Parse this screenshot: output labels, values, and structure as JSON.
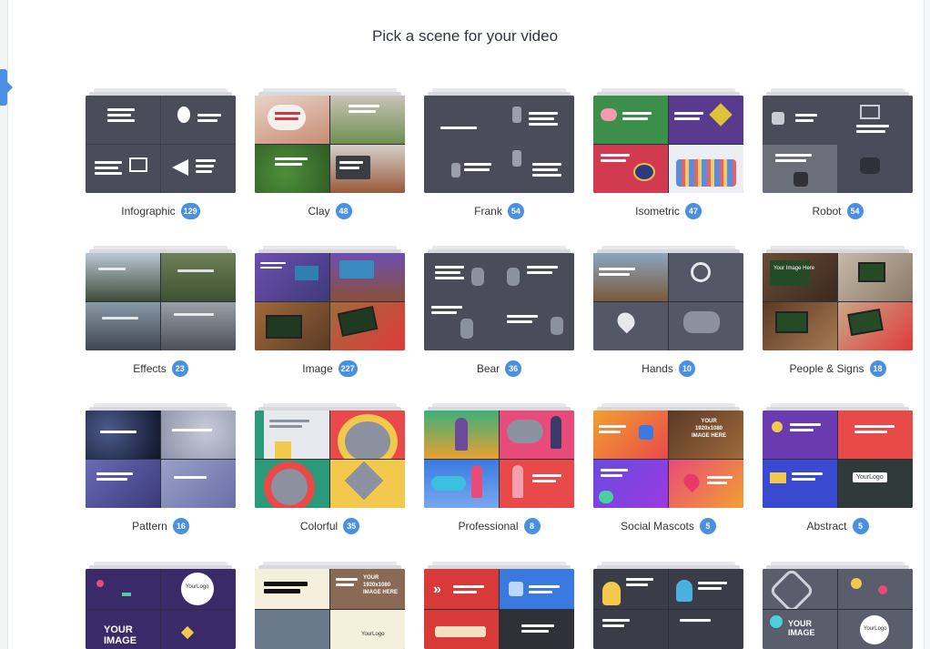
{
  "page": {
    "title": "Pick a scene for your video"
  },
  "colors": {
    "accent": "#4a90e2"
  },
  "scenes": [
    {
      "name": "Infographic",
      "count": "129",
      "theme": "dark-gray"
    },
    {
      "name": "Clay",
      "count": "48",
      "theme": "clay"
    },
    {
      "name": "Frank",
      "count": "54",
      "theme": "dark-gray"
    },
    {
      "name": "Isometric",
      "count": "47",
      "theme": "isometric"
    },
    {
      "name": "Robot",
      "count": "54",
      "theme": "dark-gray"
    },
    {
      "name": "Effects",
      "count": "23",
      "theme": "city"
    },
    {
      "name": "Image",
      "count": "227",
      "theme": "photo"
    },
    {
      "name": "Bear",
      "count": "36",
      "theme": "dark-gray"
    },
    {
      "name": "Hands",
      "count": "10",
      "theme": "dark-gray"
    },
    {
      "name": "People & Signs",
      "count": "18",
      "theme": "photo"
    },
    {
      "name": "Pattern",
      "count": "16",
      "theme": "pattern"
    },
    {
      "name": "Colorful",
      "count": "35",
      "theme": "colorful"
    },
    {
      "name": "Professional",
      "count": "8",
      "theme": "professional"
    },
    {
      "name": "Social Mascots",
      "count": "5",
      "theme": "mascots"
    },
    {
      "name": "Abstract",
      "count": "5",
      "theme": "abstract"
    },
    {
      "theme": "party",
      "overlay": "YOUR IMAGE",
      "logo": "YourLogo"
    },
    {
      "theme": "mixed",
      "overlay": "YOUR 1920x1080 IMAGE HERE",
      "logo": "YourLogo"
    },
    {
      "theme": "red-blue"
    },
    {
      "theme": "mascot-dark"
    },
    {
      "theme": "circles",
      "overlay": "YOUR IMAGE",
      "logo": "YourLogo"
    }
  ],
  "overlays": {
    "social_mascots_text": "YOUR 1920x1080 IMAGE HERE",
    "abstract_logo": "YourLogo",
    "people_signs_text": "Your Image Here"
  }
}
